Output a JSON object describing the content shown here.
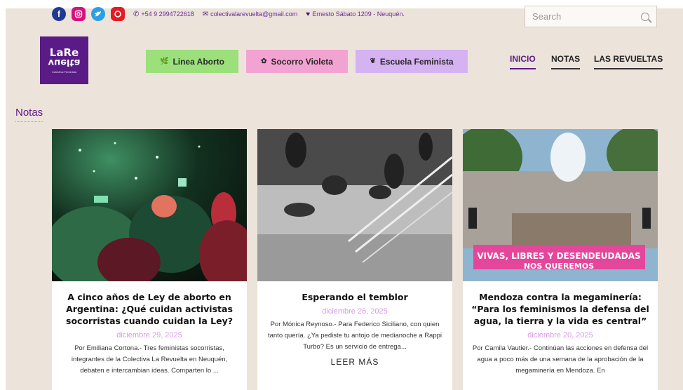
{
  "contact": {
    "phone": "+54 9 2994722618",
    "email": "colectivalarevuelta@gmail.com",
    "address": "Ernesto Sábato 1209 - Neuquén."
  },
  "social": [
    "facebook-icon",
    "instagram-icon",
    "twitter-icon",
    "youtube-icon"
  ],
  "search": {
    "placeholder": "Search"
  },
  "logo": {
    "line1": "LaRe",
    "line2": "vuelta",
    "tagline": "Colectiva Feminista"
  },
  "pills": [
    {
      "label": "Linea Aborto",
      "color": "#9be07a"
    },
    {
      "label": "Socorro Violeta",
      "color": "#f3a3d2"
    },
    {
      "label": "Escuela Feminista",
      "color": "#d5b2f2"
    }
  ],
  "nav": [
    {
      "label": "INICIO",
      "active": true
    },
    {
      "label": "NOTAS",
      "active": false
    },
    {
      "label": "LAS REVUELTAS",
      "active": false
    }
  ],
  "section": {
    "title": "Notas"
  },
  "cards": [
    {
      "title": "A cinco años de Ley de aborto en Argentina: ¿Qué cuidan activistas socorristas cuando cuidan la Ley?",
      "date": "diciembre 29, 2025",
      "excerpt": "Por Emiliana Cortona.- Tres feministas socorristas, integrantes de la Colectiva La Revuelta en Neuquén, debaten e intercambian ideas. Comparten lo ..."
    },
    {
      "title": "Esperando el temblor",
      "date": "diciembre 26, 2025",
      "excerpt": "Por Mónica Reynoso.- Para Federico Siciliano, con quien tanto quería. ¿Ya pediste tu antojo de medianoche a Rappi Turbo? Es un servicio de entrega...",
      "more": "LEER MÁS"
    },
    {
      "title": "Mendoza contra la megaminería: “Para los feminismos la defensa del agua, la tierra y la vida es central”",
      "date": "diciembre 20, 2025",
      "excerpt": "Por Camila Vautier.- Continúan las acciones en defensa del agua a poco más de una semana de la aprobación de la megaminería en Mendoza. En",
      "banner": "VIVAS, LIBRES Y DESENDEUDADAS NOS QUEREMOS"
    }
  ],
  "colors": {
    "brand": "#5a1b86",
    "background": "#ece3db",
    "date": "#d99be5"
  }
}
